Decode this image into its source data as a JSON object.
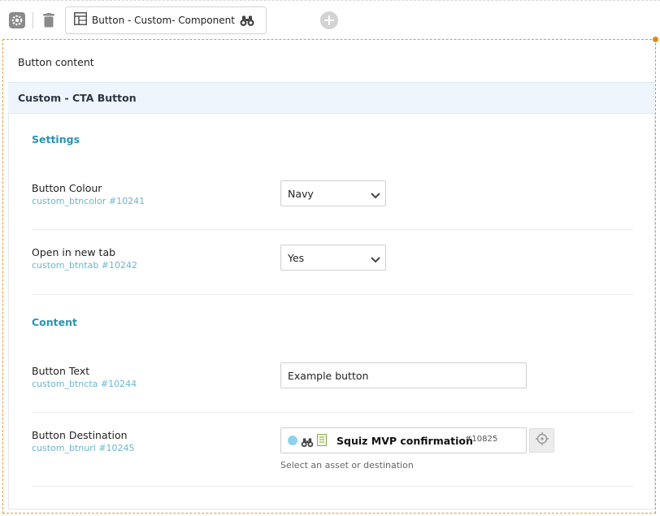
{
  "toolbar": {
    "tab_label": "Button - Custom- Component",
    "icons": [
      "gear-icon",
      "trash-icon",
      "layout-icon",
      "binoculars-icon",
      "add-icon"
    ]
  },
  "panel": {
    "title": "Button content",
    "section_title": "Custom - CTA Button"
  },
  "groups": {
    "settings": "Settings",
    "content": "Content"
  },
  "fields": {
    "button_colour": {
      "label": "Button Colour",
      "key": "custom_btncolor #10241",
      "value": "Navy"
    },
    "open_new_tab": {
      "label": "Open in new tab",
      "key": "custom_btntab #10242",
      "value": "Yes"
    },
    "button_text": {
      "label": "Button Text",
      "key": "custom_btncta #10244",
      "value": "Example button"
    },
    "button_destination": {
      "label": "Button Destination",
      "key": "custom_btnurl #10245",
      "asset_name": "Squiz MVP confirmation",
      "asset_id": "#10825",
      "helper": "Select an asset or destination"
    }
  },
  "colors": {
    "accent_border": "#e39a2f",
    "group_label": "#2a93b0",
    "field_key": "#6cb6cc",
    "section_bg": "#eef5fd"
  }
}
